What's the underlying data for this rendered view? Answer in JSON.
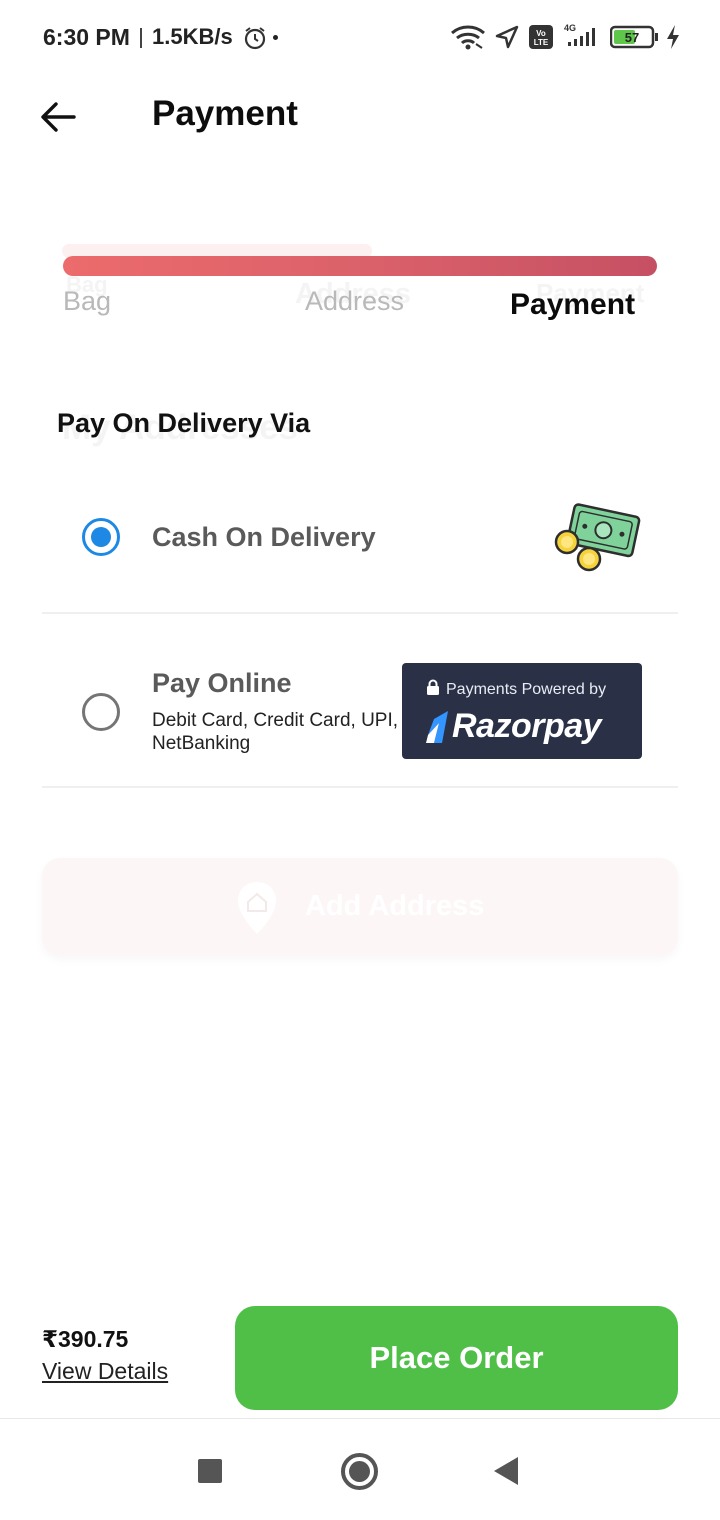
{
  "status_bar": {
    "time": "6:30 PM",
    "network_speed": "1.5KB/s",
    "network_type": "4G",
    "volte": "Vo LTE",
    "battery": "57",
    "icons": [
      "alarm-icon",
      "wifi-icon",
      "location-icon",
      "volte-icon",
      "signal-icon",
      "battery-icon",
      "charging-icon"
    ]
  },
  "header": {
    "title": "Payment",
    "back_icon": "arrow-left-icon"
  },
  "stepper": {
    "steps": [
      {
        "label": "Bag",
        "state": "done"
      },
      {
        "label": "Address",
        "state": "done"
      },
      {
        "label": "Payment",
        "state": "active"
      }
    ],
    "progress": 1.0,
    "gradient": [
      "#ec6b6c",
      "#c65063"
    ]
  },
  "payment": {
    "section_title": "Pay On Delivery Via",
    "options": [
      {
        "title": "Cash On Delivery",
        "subtitle": "",
        "selected": true,
        "icon": "cash-coins-icon"
      },
      {
        "title": "Pay Online",
        "subtitle": "Debit Card, Credit Card, UPI, NetBanking",
        "selected": false,
        "icon": "razorpay-badge"
      }
    ],
    "razorpay": {
      "caption": "Payments Powered by",
      "brand": "Razorpay"
    }
  },
  "ghost": {
    "step_bag": "Bag",
    "step_address": "Address",
    "step_payment": "Payment",
    "section": "My Addresses",
    "add_address": "Add Address"
  },
  "footer": {
    "price": "₹390.75",
    "view_details": "View Details",
    "place_order": "Place Order"
  },
  "colors": {
    "accent_blue": "#1e88e5",
    "place_order_green": "#4fbf47",
    "razorpay_dark": "#2a3147"
  },
  "nav_bar": {
    "buttons": [
      "recents-button",
      "home-button",
      "back-button"
    ]
  }
}
